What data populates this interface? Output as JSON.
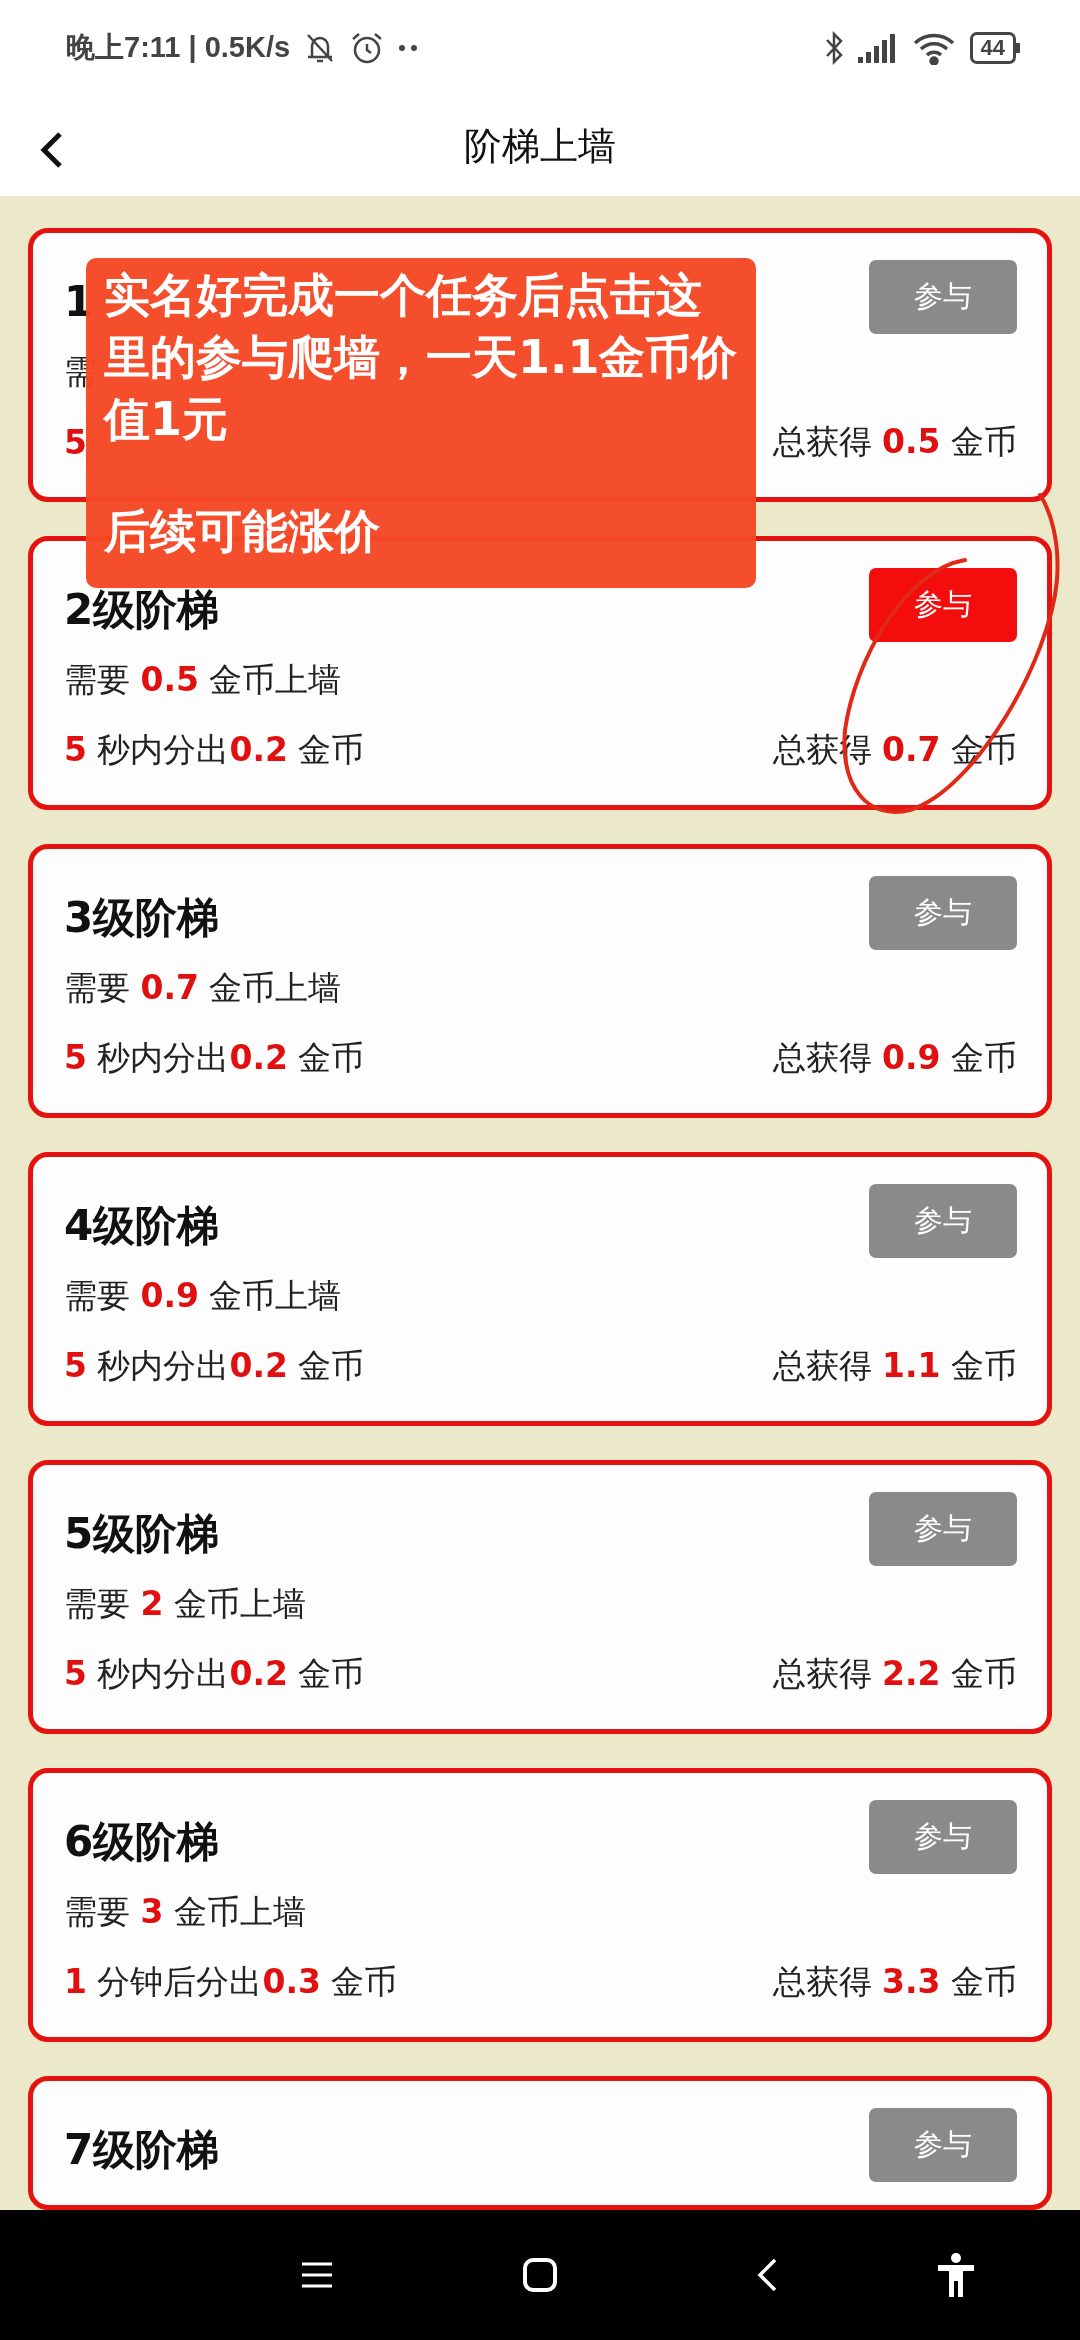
{
  "status_bar": {
    "time": "晚上7:11 | 0.5K/s",
    "battery": "44"
  },
  "header": {
    "title": "阶梯上墙"
  },
  "tiers": [
    {
      "title": "1",
      "button": "参与",
      "selected": false,
      "need": {
        "label": "需"
      },
      "payout": {
        "value": "5"
      },
      "total": {
        "label": "总获得",
        "value": "0.5",
        "unit": "金币"
      }
    },
    {
      "title": "2级阶梯",
      "button": "参与",
      "selected": true,
      "need": {
        "label": "需要",
        "value": "0.5",
        "unit": "金币上墙"
      },
      "payout": {
        "value": "5",
        "text": "秒内分出",
        "amount": "0.2",
        "unit": "金币"
      },
      "total": {
        "label": "总获得",
        "value": "0.7",
        "unit": "金币"
      }
    },
    {
      "title": "3级阶梯",
      "button": "参与",
      "selected": false,
      "need": {
        "label": "需要",
        "value": "0.7",
        "unit": "金币上墙"
      },
      "payout": {
        "value": "5",
        "text": "秒内分出",
        "amount": "0.2",
        "unit": "金币"
      },
      "total": {
        "label": "总获得",
        "value": "0.9",
        "unit": "金币"
      }
    },
    {
      "title": "4级阶梯",
      "button": "参与",
      "selected": false,
      "need": {
        "label": "需要",
        "value": "0.9",
        "unit": "金币上墙"
      },
      "payout": {
        "value": "5",
        "text": "秒内分出",
        "amount": "0.2",
        "unit": "金币"
      },
      "total": {
        "label": "总获得",
        "value": "1.1",
        "unit": "金币"
      }
    },
    {
      "title": "5级阶梯",
      "button": "参与",
      "selected": false,
      "need": {
        "label": "需要",
        "value": "2",
        "unit": "金币上墙"
      },
      "payout": {
        "value": "5",
        "text": "秒内分出",
        "amount": "0.2",
        "unit": "金币"
      },
      "total": {
        "label": "总获得",
        "value": "2.2",
        "unit": "金币"
      }
    },
    {
      "title": "6级阶梯",
      "button": "参与",
      "selected": false,
      "need": {
        "label": "需要",
        "value": "3",
        "unit": "金币上墙"
      },
      "payout": {
        "value": "1",
        "text": "分钟后分出",
        "amount": "0.3",
        "unit": "金币"
      },
      "total": {
        "label": "总获得",
        "value": "3.3",
        "unit": "金币"
      }
    },
    {
      "title": "7级阶梯",
      "button": "参与",
      "selected": false
    }
  ],
  "note": {
    "paragraphs": [
      "实名好完成一个任务后点击这里的参与爬墙，一天1.1金币价值1元",
      "后续可能涨价"
    ]
  }
}
